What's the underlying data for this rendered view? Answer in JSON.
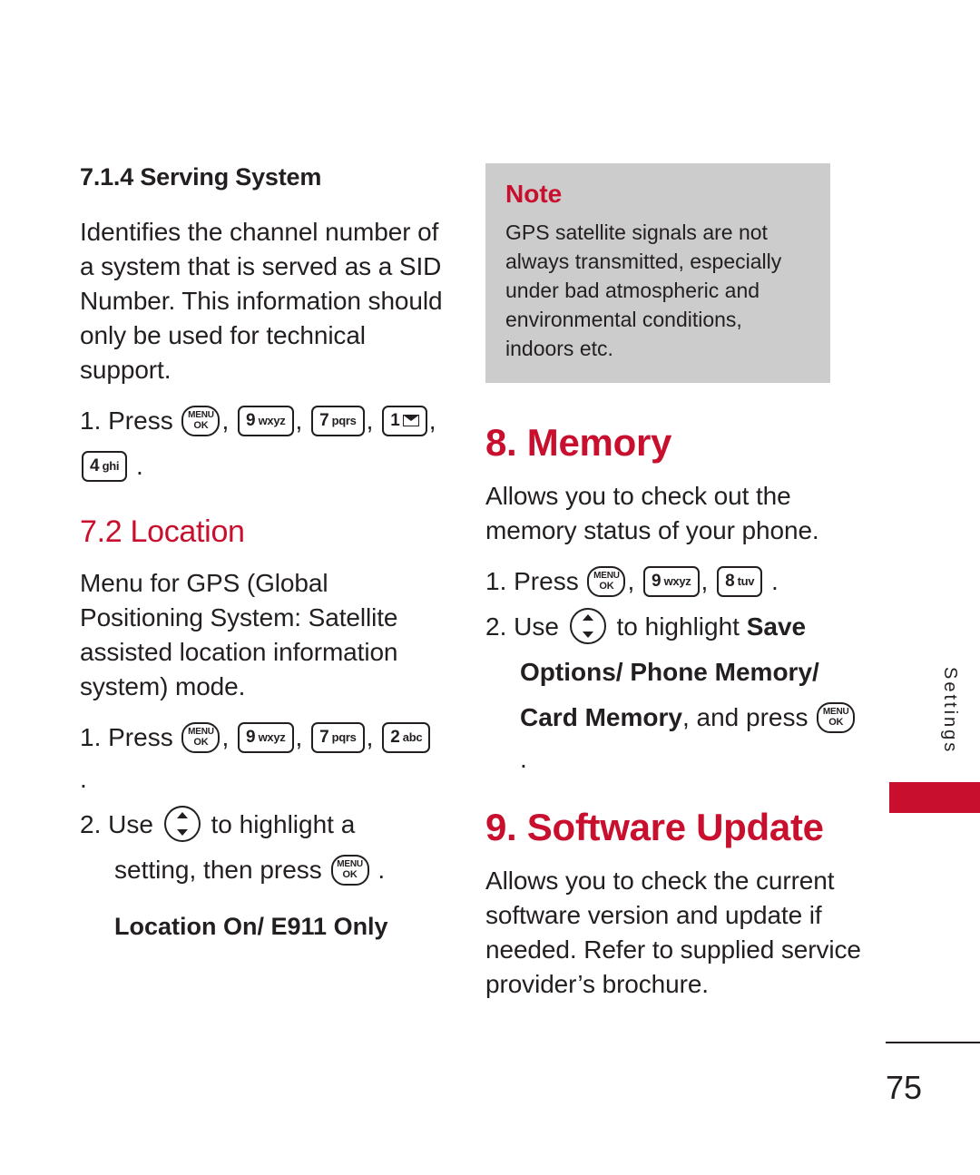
{
  "page": {
    "number": "75",
    "side_tab": "Settings"
  },
  "left_column": {
    "section_heading": "7.1.4 Serving System",
    "intro_paragraph": "Identifies the channel number of a system that is served as a SID Number. This information should only be used for technical support.",
    "step1_prefix": "1. Press",
    "step1_keys": [
      "MENU OK",
      "9 wxyz",
      "7 pqrs",
      "1 mail",
      "4 ghi"
    ],
    "location_heading": "7.2 Location",
    "location_paragraph": "Menu for GPS (Global Positioning System: Satellite assisted location information system) mode.",
    "loc_step1_prefix": "1. Press",
    "loc_step1_keys": [
      "MENU OK",
      "9 wxyz",
      "7 pqrs",
      "2 abc"
    ],
    "loc_step2_prefix": "2. Use",
    "loc_step2_mid": "to highlight a",
    "loc_step2_cont": "setting, then press",
    "loc_options": "Location On/ E911 Only"
  },
  "note": {
    "title": "Note",
    "body": "GPS satellite signals are not always transmitted, especially under bad atmospheric and environmental conditions, indoors etc."
  },
  "right_column": {
    "memory_heading": "8. Memory",
    "memory_paragraph": "Allows you to check out the memory status of your phone.",
    "mem_step1_prefix": "1. Press",
    "mem_step1_keys": [
      "MENU OK",
      "9 wxyz",
      "8 tuv"
    ],
    "mem_step2_prefix": "2. Use",
    "mem_step2_mid": "to highlight",
    "mem_step2_bold1": "Save",
    "mem_step2_bold2": "Options/ Phone Memory/",
    "mem_step2_bold3": "Card Memory",
    "mem_step2_tail": ", and press",
    "software_heading": "9. Software Update",
    "software_paragraph": "Allows you to check the current software version and update if needed. Refer to supplied service provider’s brochure."
  },
  "keys": {
    "menu": "MENU",
    "ok": "OK",
    "n9": "9",
    "n9_letters": "wxyz",
    "n7": "7",
    "n7_letters": "pqrs",
    "n1": "1",
    "n2": "2",
    "n2_letters": "abc",
    "n4": "4",
    "n4_letters": "ghi",
    "n8": "8",
    "n8_letters": "tuv"
  },
  "colors": {
    "accent_red": "#c8102e",
    "note_background": "#cccccc",
    "text": "#231f20"
  }
}
